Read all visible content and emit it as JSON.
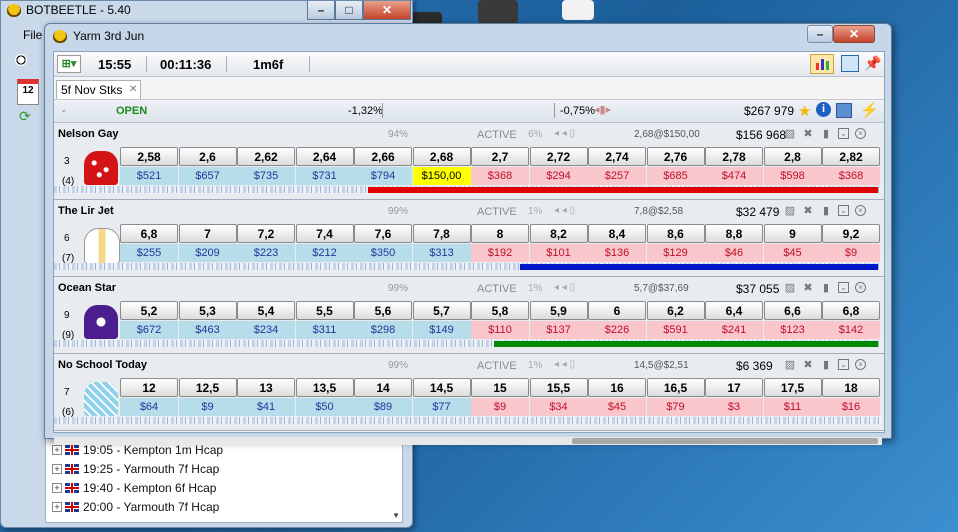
{
  "colors": {
    "accent_red": "#e30000",
    "accent_blue": "#0018c8",
    "accent_green": "#008a00",
    "back": "#b7dcea",
    "lay": "#f8c6cb",
    "highlight": "#ffff00"
  },
  "back_window": {
    "title": "BOTBEETLE - 5.40",
    "menu_first": "File",
    "tree": [
      {
        "label": "19:05 - Kempton 1m Hcap"
      },
      {
        "label": "19:25 - Yarmouth 7f Hcap"
      },
      {
        "label": "19:40 - Kempton 6f Hcap"
      },
      {
        "label": "20:00 - Yarmouth 7f Hcap"
      }
    ],
    "calendar_icon_label": "12"
  },
  "main_window": {
    "title": "Yarm  3rd Jun",
    "toolbar": {
      "time": "15:55",
      "countdown": "00:11:36",
      "distance": "1m6f"
    },
    "tab": "5f Nov Stks",
    "market": {
      "status": "OPEN",
      "back_pct": "-1,32%",
      "lay_pct": "-0,75%",
      "matched": "$267 979"
    },
    "runners": [
      {
        "name": "Nelson Gay",
        "pct": "94%",
        "status": "ACTIVE",
        "status_pct": "6%",
        "last": "2,68@$150,00",
        "pl": "$156 968",
        "saddle": "3",
        "draw": "(4)",
        "back_prices": [
          "2,58",
          "2,6",
          "2,62",
          "2,64",
          "2,66",
          "2,68"
        ],
        "back_amounts": [
          "$521",
          "$657",
          "$735",
          "$731",
          "$794",
          "$150,00"
        ],
        "lay_prices": [
          "2,7",
          "2,72",
          "2,74",
          "2,76",
          "2,78",
          "2,8",
          "2,82"
        ],
        "lay_amounts": [
          "$368",
          "$294",
          "$257",
          "$685",
          "$474",
          "$598",
          "$368"
        ]
      },
      {
        "name": "The Lir Jet",
        "pct": "99%",
        "status": "ACTIVE",
        "status_pct": "1%",
        "last": "7,8@$2,58",
        "pl": "$32 479",
        "saddle": "6",
        "draw": "(7)",
        "back_prices": [
          "6,8",
          "7",
          "7,2",
          "7,4",
          "7,6",
          "7,8"
        ],
        "back_amounts": [
          "$255",
          "$209",
          "$223",
          "$212",
          "$350",
          "$313"
        ],
        "lay_prices": [
          "8",
          "8,2",
          "8,4",
          "8,6",
          "8,8",
          "9",
          "9,2"
        ],
        "lay_amounts": [
          "$192",
          "$101",
          "$136",
          "$129",
          "$46",
          "$45",
          "$9"
        ]
      },
      {
        "name": "Ocean Star",
        "pct": "99%",
        "status": "ACTIVE",
        "status_pct": "1%",
        "last": "5,7@$37,69",
        "pl": "$37 055",
        "saddle": "9",
        "draw": "(9)",
        "back_prices": [
          "5,2",
          "5,3",
          "5,4",
          "5,5",
          "5,6",
          "5,7"
        ],
        "back_amounts": [
          "$672",
          "$463",
          "$234",
          "$311",
          "$298",
          "$149"
        ],
        "lay_prices": [
          "5,8",
          "5,9",
          "6",
          "6,2",
          "6,4",
          "6,6",
          "6,8"
        ],
        "lay_amounts": [
          "$110",
          "$137",
          "$226",
          "$591",
          "$241",
          "$123",
          "$142"
        ]
      },
      {
        "name": "No School Today",
        "pct": "99%",
        "status": "ACTIVE",
        "status_pct": "1%",
        "last": "14,5@$2,51",
        "pl": "$6 369",
        "saddle": "7",
        "draw": "(6)",
        "back_prices": [
          "12",
          "12,5",
          "13",
          "13,5",
          "14",
          "14,5"
        ],
        "back_amounts": [
          "$64",
          "$9",
          "$41",
          "$50",
          "$89",
          "$77"
        ],
        "lay_prices": [
          "15",
          "15,5",
          "16",
          "16,5",
          "17",
          "17,5",
          "18"
        ],
        "lay_amounts": [
          "$9",
          "$34",
          "$45",
          "$79",
          "$3",
          "$11",
          "$16"
        ]
      }
    ]
  }
}
